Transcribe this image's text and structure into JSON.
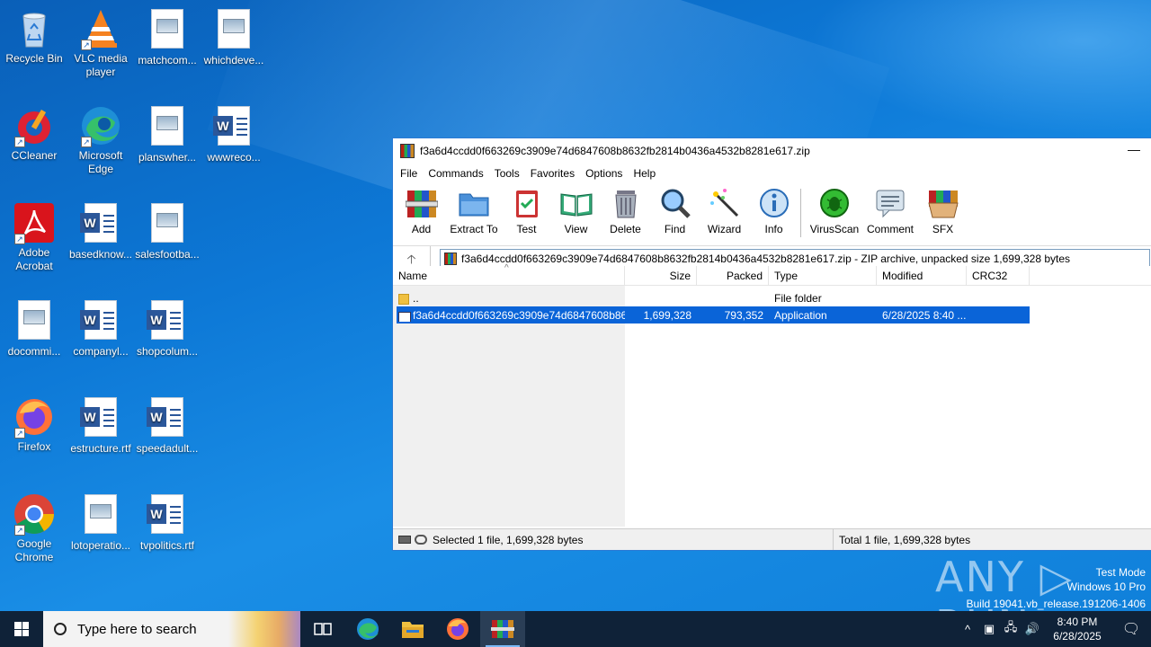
{
  "desktop": {
    "icons": [
      {
        "label": "Recycle Bin",
        "icon": "recycle-bin-icon"
      },
      {
        "label": "VLC media player",
        "icon": "vlc-icon"
      },
      {
        "label": "matchcom...",
        "icon": "image-file-icon"
      },
      {
        "label": "whichdeve...",
        "icon": "image-file-icon"
      },
      {
        "label": "CCleaner",
        "icon": "ccleaner-icon"
      },
      {
        "label": "Microsoft Edge",
        "icon": "edge-icon"
      },
      {
        "label": "planswher...",
        "icon": "image-file-icon"
      },
      {
        "label": "wwwreco...",
        "icon": "word-doc-icon"
      },
      {
        "label": "Adobe Acrobat",
        "icon": "acrobat-icon"
      },
      {
        "label": "basedknow...",
        "icon": "word-doc-icon"
      },
      {
        "label": "salesfootba...",
        "icon": "image-file-icon"
      },
      {
        "label": "docommi...",
        "icon": "image-file-icon"
      },
      {
        "label": "companyl...",
        "icon": "word-doc-icon"
      },
      {
        "label": "shopcolum...",
        "icon": "word-doc-icon"
      },
      {
        "label": "Firefox",
        "icon": "firefox-icon"
      },
      {
        "label": "estructure.rtf",
        "icon": "word-doc-icon"
      },
      {
        "label": "speedadult...",
        "icon": "word-doc-icon"
      },
      {
        "label": "Google Chrome",
        "icon": "chrome-icon"
      },
      {
        "label": "lotoperatio...",
        "icon": "image-file-icon"
      },
      {
        "label": "tvpolitics.rtf",
        "icon": "word-doc-icon"
      }
    ]
  },
  "winrar": {
    "title": "f3a6d4ccdd0f663269c3909e74d6847608b8632fb2814b0436a4532b8281e617.zip",
    "minimize": "—",
    "menu": [
      "File",
      "Commands",
      "Tools",
      "Favorites",
      "Options",
      "Help"
    ],
    "toolbar": [
      "Add",
      "Extract To",
      "Test",
      "View",
      "Delete",
      "Find",
      "Wizard",
      "Info",
      "VirusScan",
      "Comment",
      "SFX"
    ],
    "up_arrow": "🡡",
    "path": "f3a6d4ccdd0f663269c3909e74d6847608b8632fb2814b0436a4532b8281e617.zip - ZIP archive, unpacked size 1,699,328 bytes",
    "columns": [
      "Name",
      "Size",
      "Packed",
      "Type",
      "Modified",
      "CRC32"
    ],
    "rows": [
      {
        "name": "..",
        "size": "",
        "packed": "",
        "type": "File folder",
        "modified": "",
        "crc": ""
      },
      {
        "name": "f3a6d4ccdd0f663269c3909e74d6847608b86...",
        "size": "1,699,328",
        "packed": "793,352",
        "type": "Application",
        "modified": "6/28/2025 8:40 ...",
        "crc": ""
      }
    ],
    "status_left": "Selected 1 file, 1,699,328 bytes",
    "status_right": "Total 1 file, 1,699,328 bytes"
  },
  "watermark": {
    "brand": "ANY ▷ RUN",
    "mode": "Test Mode",
    "edition": "Windows 10 Pro",
    "build": "Build 19041.vb_release.191206-1406"
  },
  "taskbar": {
    "search_placeholder": "Type here to search",
    "time": "8:40 PM",
    "date": "6/28/2025",
    "tray_chevron": "^",
    "notification": "🗨"
  },
  "colors": {
    "selection": "#0a64d8",
    "taskbar": "#0f2238",
    "desktop": "#0d78d6"
  }
}
